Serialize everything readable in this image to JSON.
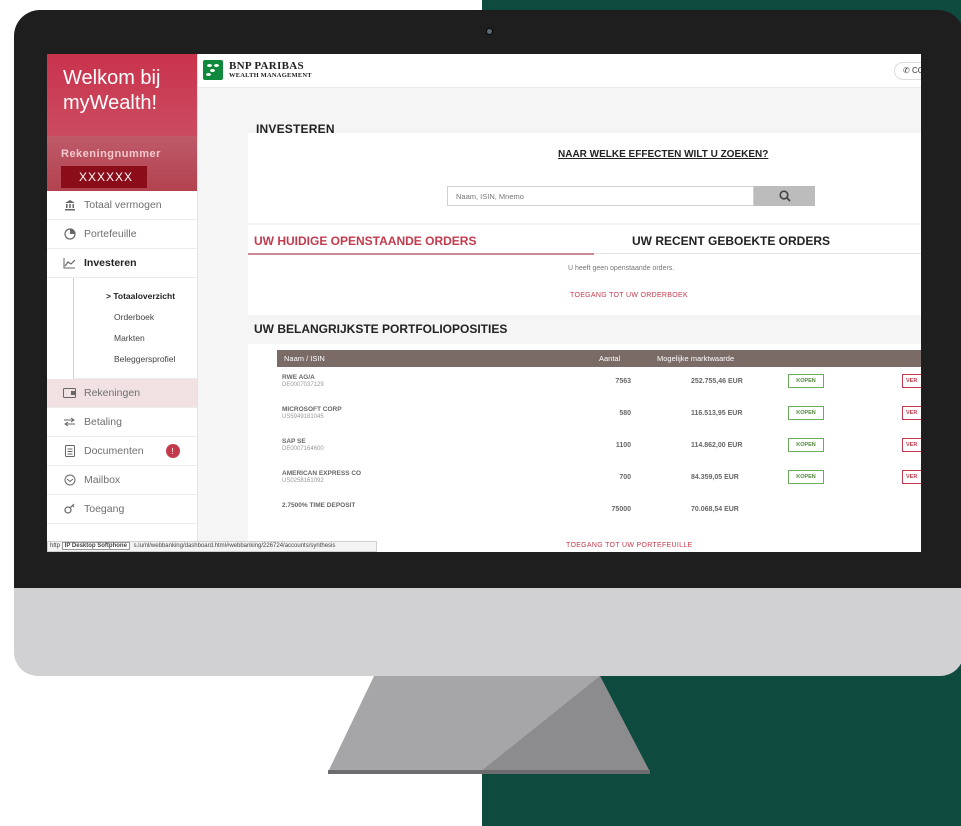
{
  "sidebar": {
    "welcome_line1": "Welkom bij",
    "welcome_line2": "myWealth!",
    "account_label": "Rekeningnummer",
    "account_number": "XXXXXX",
    "items": [
      {
        "label": "Totaal vermogen",
        "icon": "bank-icon"
      },
      {
        "label": "Portefeuille",
        "icon": "pie-chart-icon"
      },
      {
        "label": "Investeren",
        "icon": "line-chart-icon"
      },
      {
        "label": "Rekeningen",
        "icon": "card-icon"
      },
      {
        "label": "Betaling",
        "icon": "transfer-icon"
      },
      {
        "label": "Documenten",
        "icon": "document-icon",
        "badge": "!"
      },
      {
        "label": "Mailbox",
        "icon": "mailbox-icon"
      },
      {
        "label": "Toegang",
        "icon": "key-icon"
      }
    ],
    "subitems": [
      "> Totaaloverzicht",
      "Orderboek",
      "Markten",
      "Beleggersprofiel"
    ]
  },
  "statusbar": {
    "prefix": "http",
    "tooltip": "IP Desktop Softphone",
    "url": "s.lu/nl/webbanking/dashboard.html#webbanking/226724/accounts/synthesis"
  },
  "header": {
    "brand_line1": "BNP PARIBAS",
    "brand_line2": "WEALTH MANAGEMENT",
    "contact_label": "CO"
  },
  "main": {
    "section_title": "INVESTEREN",
    "search_question": "NAAR WELKE EFFECTEN WILT U ZOEKEN?",
    "search_placeholder": "Naam, ISIN, Mnemo",
    "tab_open": "UW HUIDIGE OPENSTAANDE ORDERS",
    "tab_recent": "UW RECENT GEBOEKTE ORDERS",
    "no_orders": "U heeft geen openstaande orders.",
    "orderbook_link": "TOEGANG TOT UW ORDERBOEK",
    "portfolio_title": "UW BELANGRIJKSTE PORTFOLIOPOSITIES",
    "portfolio_link": "TOEGANG TOT UW PORTEFEUILLE"
  },
  "portfolio": {
    "headers": [
      "Naam / ISIN",
      "Aantal",
      "Mogelijke marktwaarde"
    ],
    "buy_label": "KOPEN",
    "sell_label": "VER",
    "rows": [
      {
        "name": "RWE AG/A",
        "isin": "DE0007037129",
        "qty": "7563",
        "value": "252.755,46 EUR",
        "actions": true
      },
      {
        "name": "MICROSOFT CORP",
        "isin": "US5949181045",
        "qty": "580",
        "value": "116.513,95 EUR",
        "actions": true
      },
      {
        "name": "SAP SE",
        "isin": "DE0007164600",
        "qty": "1100",
        "value": "114.862,00 EUR",
        "actions": true
      },
      {
        "name": "AMERICAN EXPRESS CO",
        "isin": "US0258161092",
        "qty": "700",
        "value": "84.359,05 EUR",
        "actions": true
      },
      {
        "name": "2.7500% TIME DEPOSIT",
        "isin": "",
        "qty": "75000",
        "value": "70.068,54 EUR",
        "actions": false
      }
    ]
  },
  "colors": {
    "brand_red": "#c43a4d",
    "brand_green": "#0f8a3c",
    "backdrop_green": "#0e4a3d",
    "table_header": "#7b6b67"
  }
}
